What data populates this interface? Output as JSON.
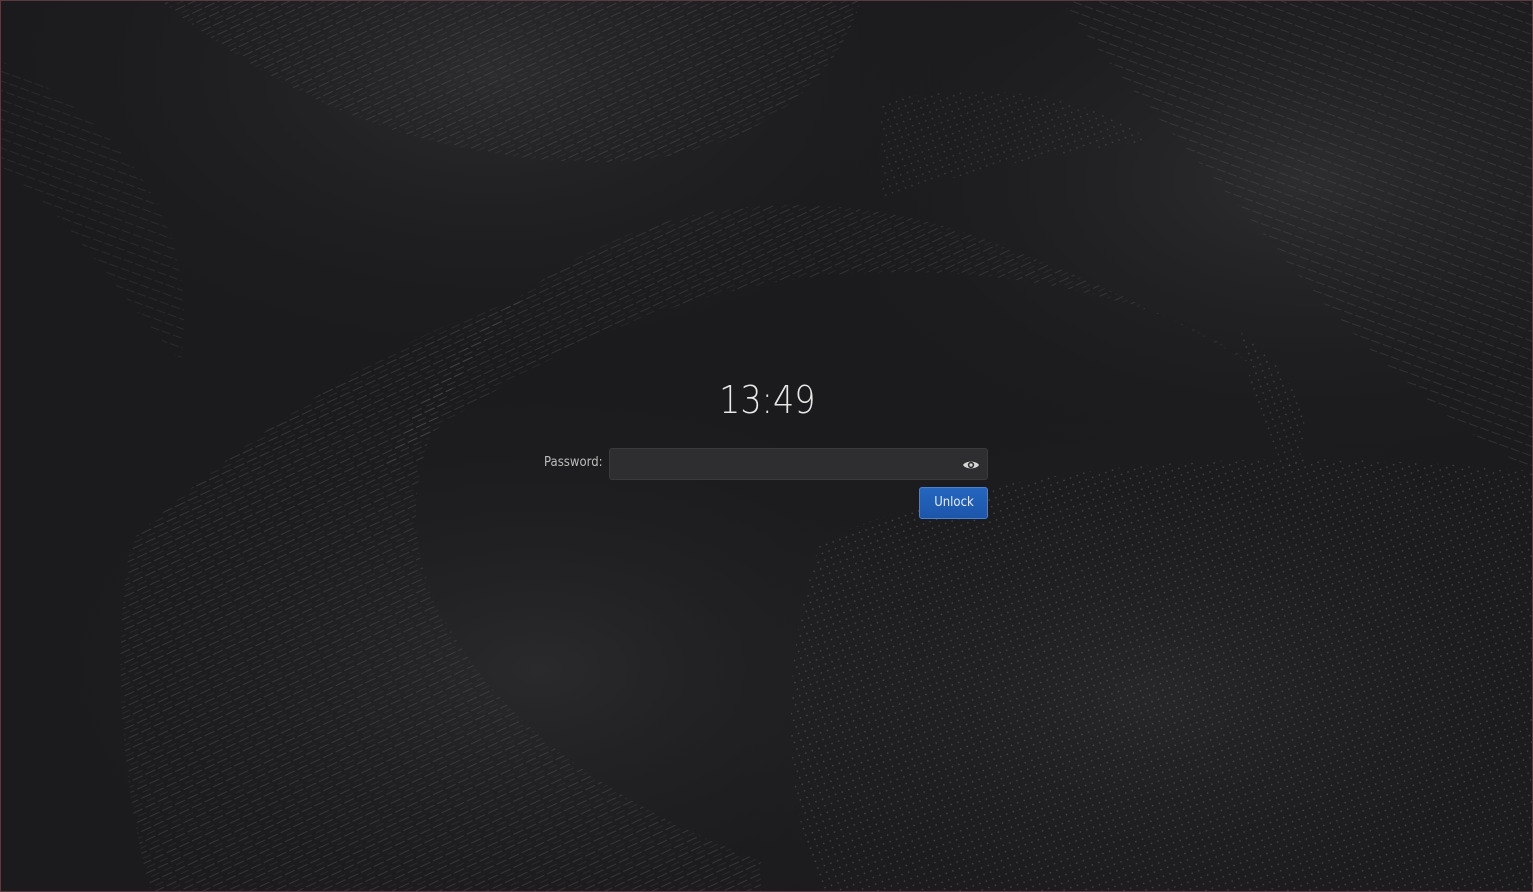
{
  "lock_screen": {
    "time": "13:49",
    "password_label": "Password:",
    "password_value": "",
    "password_placeholder": "",
    "reveal_icon": "eye-icon",
    "unlock_label": "Unlock"
  },
  "colors": {
    "background": "#1b1b1d",
    "accent": "#1f5cb6",
    "field": "#2e2e30",
    "text": "#e8e8e8"
  }
}
